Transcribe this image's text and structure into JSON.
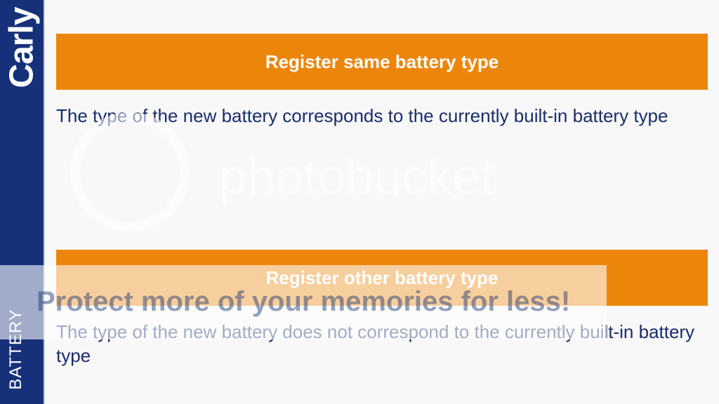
{
  "sidebar": {
    "logo": "Carly",
    "section": "BATTERY"
  },
  "options": [
    {
      "button_label": "Register same battery type",
      "description": "The type of the new battery corresponds to the currently built-in battery type"
    },
    {
      "button_label": "Register other battery type",
      "description": "The type of the new battery does not correspond to the currently built-in battery type"
    }
  ],
  "watermark": {
    "text": "photobucket",
    "banner": "Protect more of your memories for less!"
  },
  "colors": {
    "sidebar": "#16317a",
    "accent": "#ec860a",
    "text": "#1a2d6b",
    "background": "#f8f8f8"
  }
}
